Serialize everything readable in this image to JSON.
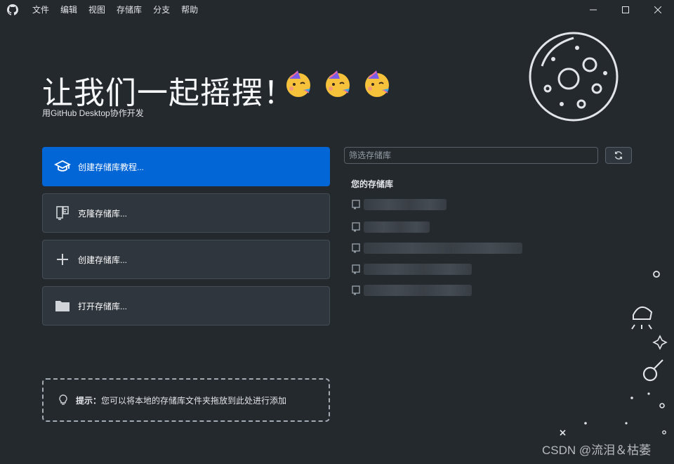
{
  "titlebar": {
    "menu": [
      "文件",
      "编辑",
      "视图",
      "存储库",
      "分支",
      "帮助"
    ]
  },
  "welcome": {
    "title": "让我们一起摇摆！",
    "subtitle": "用GitHub Desktop协作开发",
    "emojis": [
      "partying-face",
      "partying-face",
      "partying-face"
    ]
  },
  "actions": [
    {
      "label": "创建存储库教程...",
      "icon": "graduation-cap-icon",
      "primary": true
    },
    {
      "label": "克隆存储库...",
      "icon": "clone-repo-icon",
      "primary": false
    },
    {
      "label": "创建存储库...",
      "icon": "plus-icon",
      "primary": false
    },
    {
      "label": "打开存储库...",
      "icon": "folder-icon",
      "primary": false
    }
  ],
  "repos": {
    "filter_placeholder": "筛选存储库",
    "heading": "您的存储库",
    "items_count_visible": 5
  },
  "tip": {
    "label": "提示：",
    "text": "您可以将本地的存储库文件夹拖放到此处进行添加"
  },
  "watermark": "CSDN @流泪＆枯萎",
  "colors": {
    "background": "#24292e",
    "primary": "#0366d6",
    "button_bg": "#2f363d",
    "border": "#444d56"
  }
}
